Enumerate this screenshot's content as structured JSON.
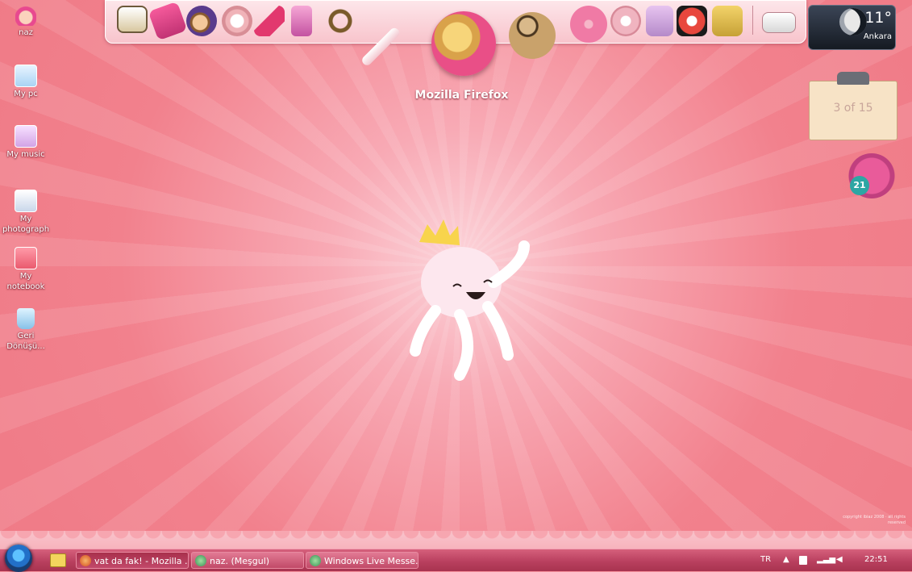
{
  "desktop": {
    "icons": [
      {
        "label": "naz"
      },
      {
        "label": "My pc"
      },
      {
        "label": "My music"
      },
      {
        "label": "My photograph"
      },
      {
        "label": "My notebook"
      },
      {
        "label": "Geri Dönüşü..."
      }
    ],
    "copyright": "copyright ibiaz 2008 · all rights reserved"
  },
  "dock": {
    "hover_label": "Mozilla Firefox",
    "items": [
      "desktop-screen",
      "lego-brick",
      "five-avatar",
      "clock-radio",
      "high-heel",
      "phone",
      "quicktime",
      "lipgloss",
      "firefox",
      "messenger",
      "disc",
      "telephone",
      "cats",
      "d-logo",
      "sims"
    ]
  },
  "weather": {
    "temp": "11°",
    "city": "Ankara"
  },
  "slideshow": {
    "counter": "3 of 15"
  },
  "calendar": {
    "day": "21"
  },
  "taskbar": {
    "tasks": [
      {
        "label": "vat da fak! - Mozilla ..."
      },
      {
        "label": "naz. (Meşgul)"
      },
      {
        "label": "Windows Live Messe..."
      }
    ],
    "tray": {
      "lang": "TR",
      "time": "22:51"
    }
  },
  "colors": {
    "accent": "#ef7a86",
    "taskbar": "#b9405f"
  }
}
